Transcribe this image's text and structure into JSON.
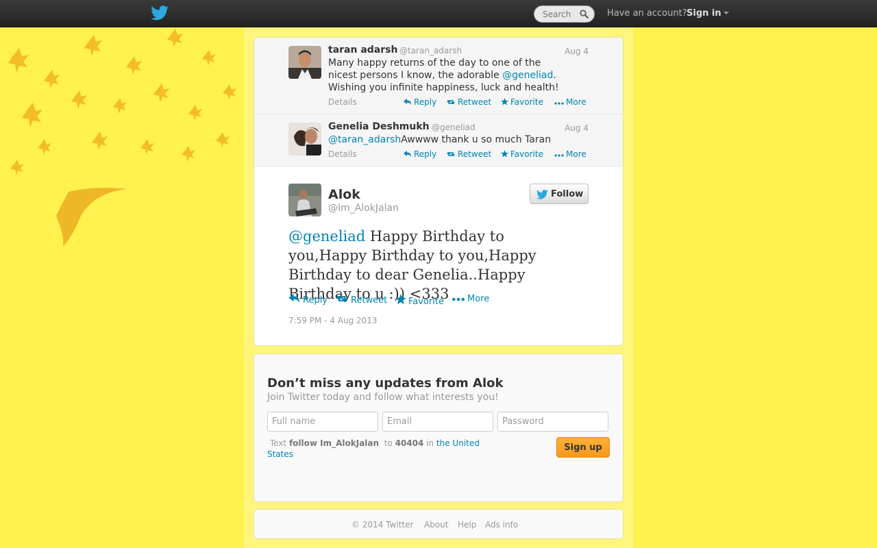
{
  "topbar": {
    "search_placeholder": "Search",
    "have_account": "Have an account?",
    "sign_in": "Sign in"
  },
  "conversation": [
    {
      "name": "taran adarsh",
      "handle": "@taran_adarsh",
      "date": "Aug 4",
      "text_before": "Many happy returns of the day to one of the nicest persons I know, the adorable ",
      "mention": "@geneliad",
      "text_after": ". Wishing you infinite happiness, luck and health!"
    },
    {
      "name": "Genelia Deshmukh",
      "handle": "@geneliad",
      "date": "Aug 4",
      "mention": "@taran_adarsh",
      "text_after": "Awwww thank u so much Taran"
    }
  ],
  "actions": {
    "details": "Details",
    "reply": "Reply",
    "retweet": "Retweet",
    "favorite": "Favorite",
    "more": "More"
  },
  "main_tweet": {
    "name": "Alok",
    "handle": "@Im_AlokJalan",
    "follow_label": "Follow",
    "mention": "@geneliad",
    "text": " Happy Birthday to you,Happy Birthday to you,Happy Birthday to dear Genelia..Happy Birthday to u :)) <333",
    "timestamp": "7:59 PM - 4 Aug 2013"
  },
  "signup": {
    "title": "Don’t miss any updates from Alok",
    "subtitle": "Join Twitter today and follow what interests you!",
    "full_name_placeholder": "Full name",
    "email_placeholder": "Email",
    "password_placeholder": "Password",
    "sms_text": "Text",
    "sms_command": "follow Im_AlokJalan",
    "sms_to": "to",
    "sms_number": "40404",
    "sms_in": "in",
    "sms_country": "the United States",
    "button": "Sign up"
  },
  "footer": {
    "copyright": "© 2014 Twitter",
    "about": "About",
    "help": "Help",
    "ads_info": "Ads info"
  },
  "colors": {
    "link": "#0084b4",
    "background": "#fff14e",
    "signup_button": "#f59a1a"
  }
}
